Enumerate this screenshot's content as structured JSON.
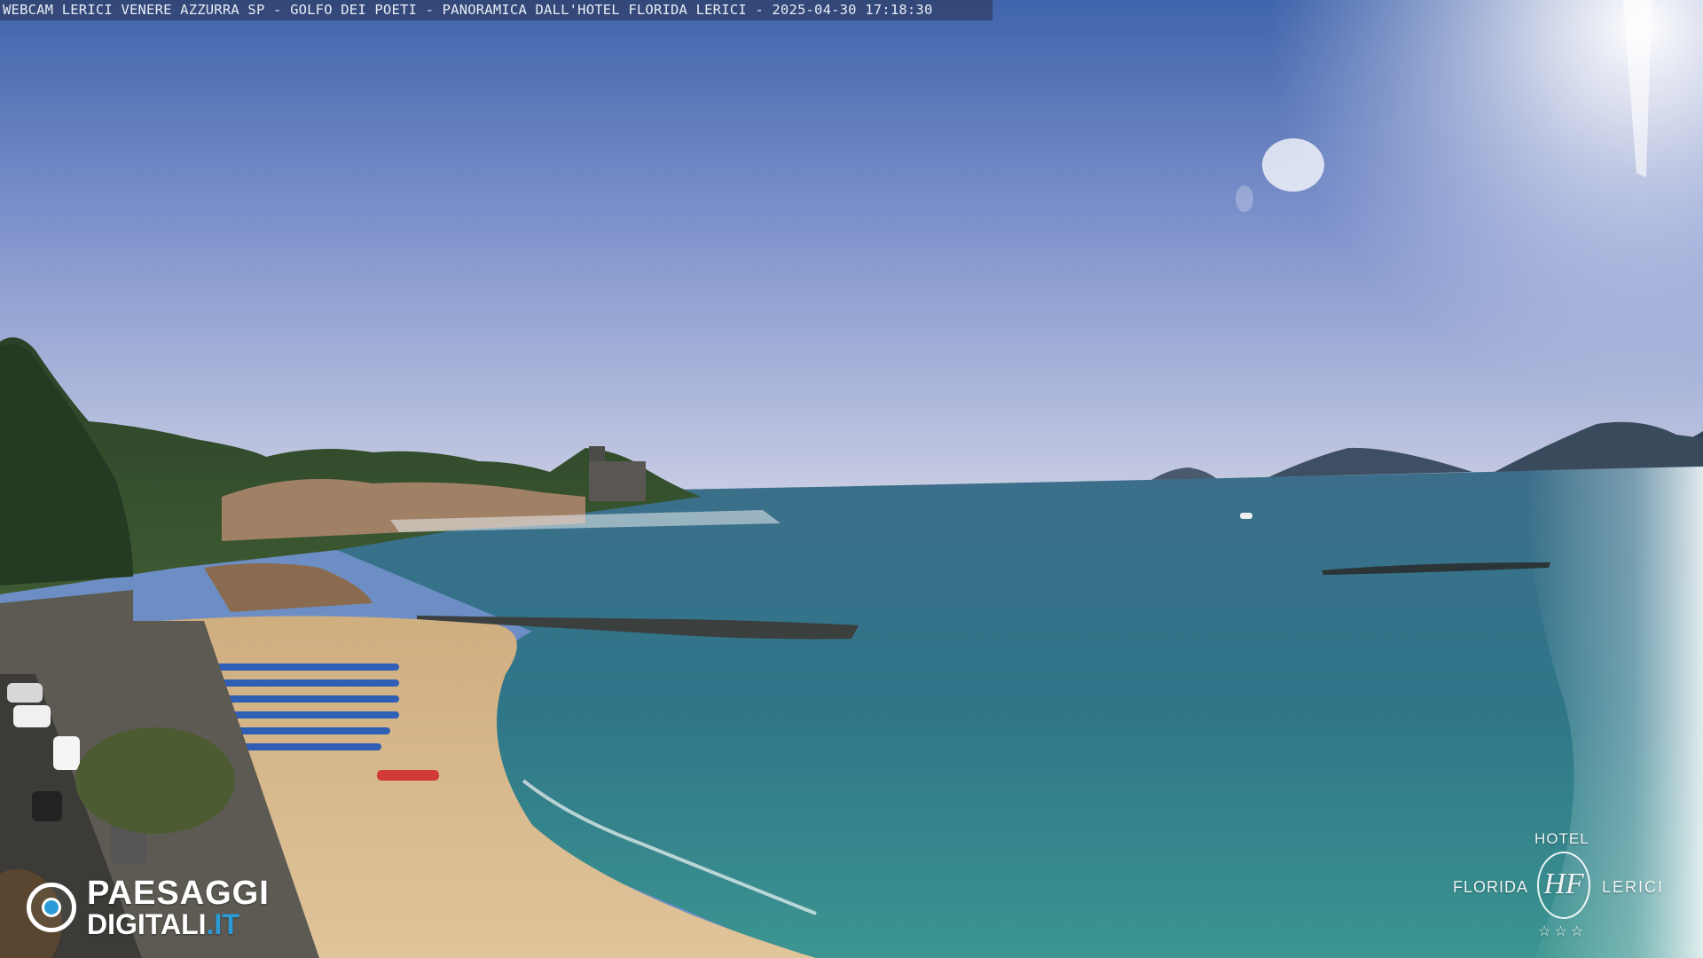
{
  "webcam": {
    "caption": "WEBCAM LERICI VENERE AZZURRA SP - GOLFO DEI POETI - PANORAMICA DALL'HOTEL FLORIDA LERICI - 2025-04-30 17:18:30"
  },
  "logo_left": {
    "line1": "PAESAGGI",
    "line2_main": "DIGITALI",
    "line2_tld": ".IT"
  },
  "logo_right": {
    "top": "HOTEL",
    "left": "FLORIDA",
    "right": "LERICI",
    "monogram": "HF",
    "stars": "☆☆☆"
  },
  "colors": {
    "sky_top": "#4d71b5",
    "sky_horizon": "#c6cce4",
    "sea_far": "#2e6f86",
    "sea_near": "#3b8f8f",
    "sand": "#d8b98c",
    "umbrella": "#2f5fb5",
    "hill": "#2f4a28",
    "accent_logo": "#2b9bd8"
  }
}
